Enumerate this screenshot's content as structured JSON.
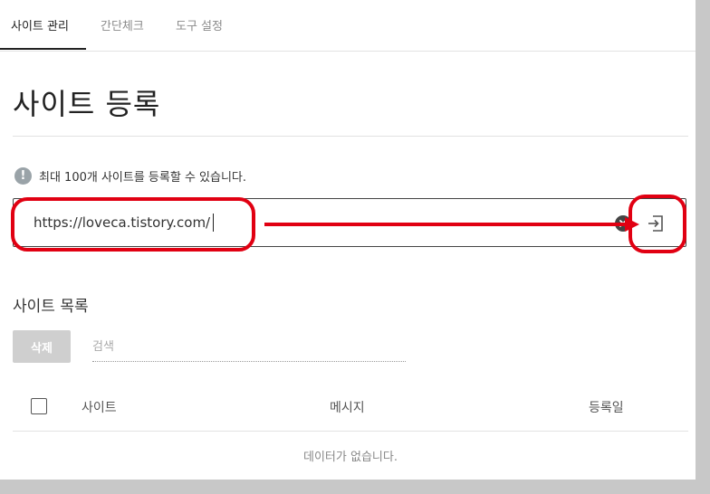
{
  "tabs": [
    {
      "label": "사이트 관리",
      "active": true
    },
    {
      "label": "간단체크",
      "active": false
    },
    {
      "label": "도구 설정",
      "active": false
    }
  ],
  "page_title": "사이트 등록",
  "notice": {
    "icon": "info-icon",
    "text": "최대 100개 사이트를 등록할 수 있습니다."
  },
  "url_input": {
    "value": "https://loveca.tistory.com/",
    "clear_icon": "clear-icon",
    "submit_icon": "submit-enter-icon"
  },
  "site_list": {
    "title": "사이트 목록",
    "delete_label": "삭제",
    "search_placeholder": "검색",
    "columns": [
      "사이트",
      "메시지",
      "등록일"
    ],
    "empty_message": "데이터가 없습니다."
  },
  "colors": {
    "annotation": "#e10012",
    "active_tab": "#222222",
    "inactive_tab": "#8a8a8a",
    "delete_button": "#cfcfcf"
  }
}
